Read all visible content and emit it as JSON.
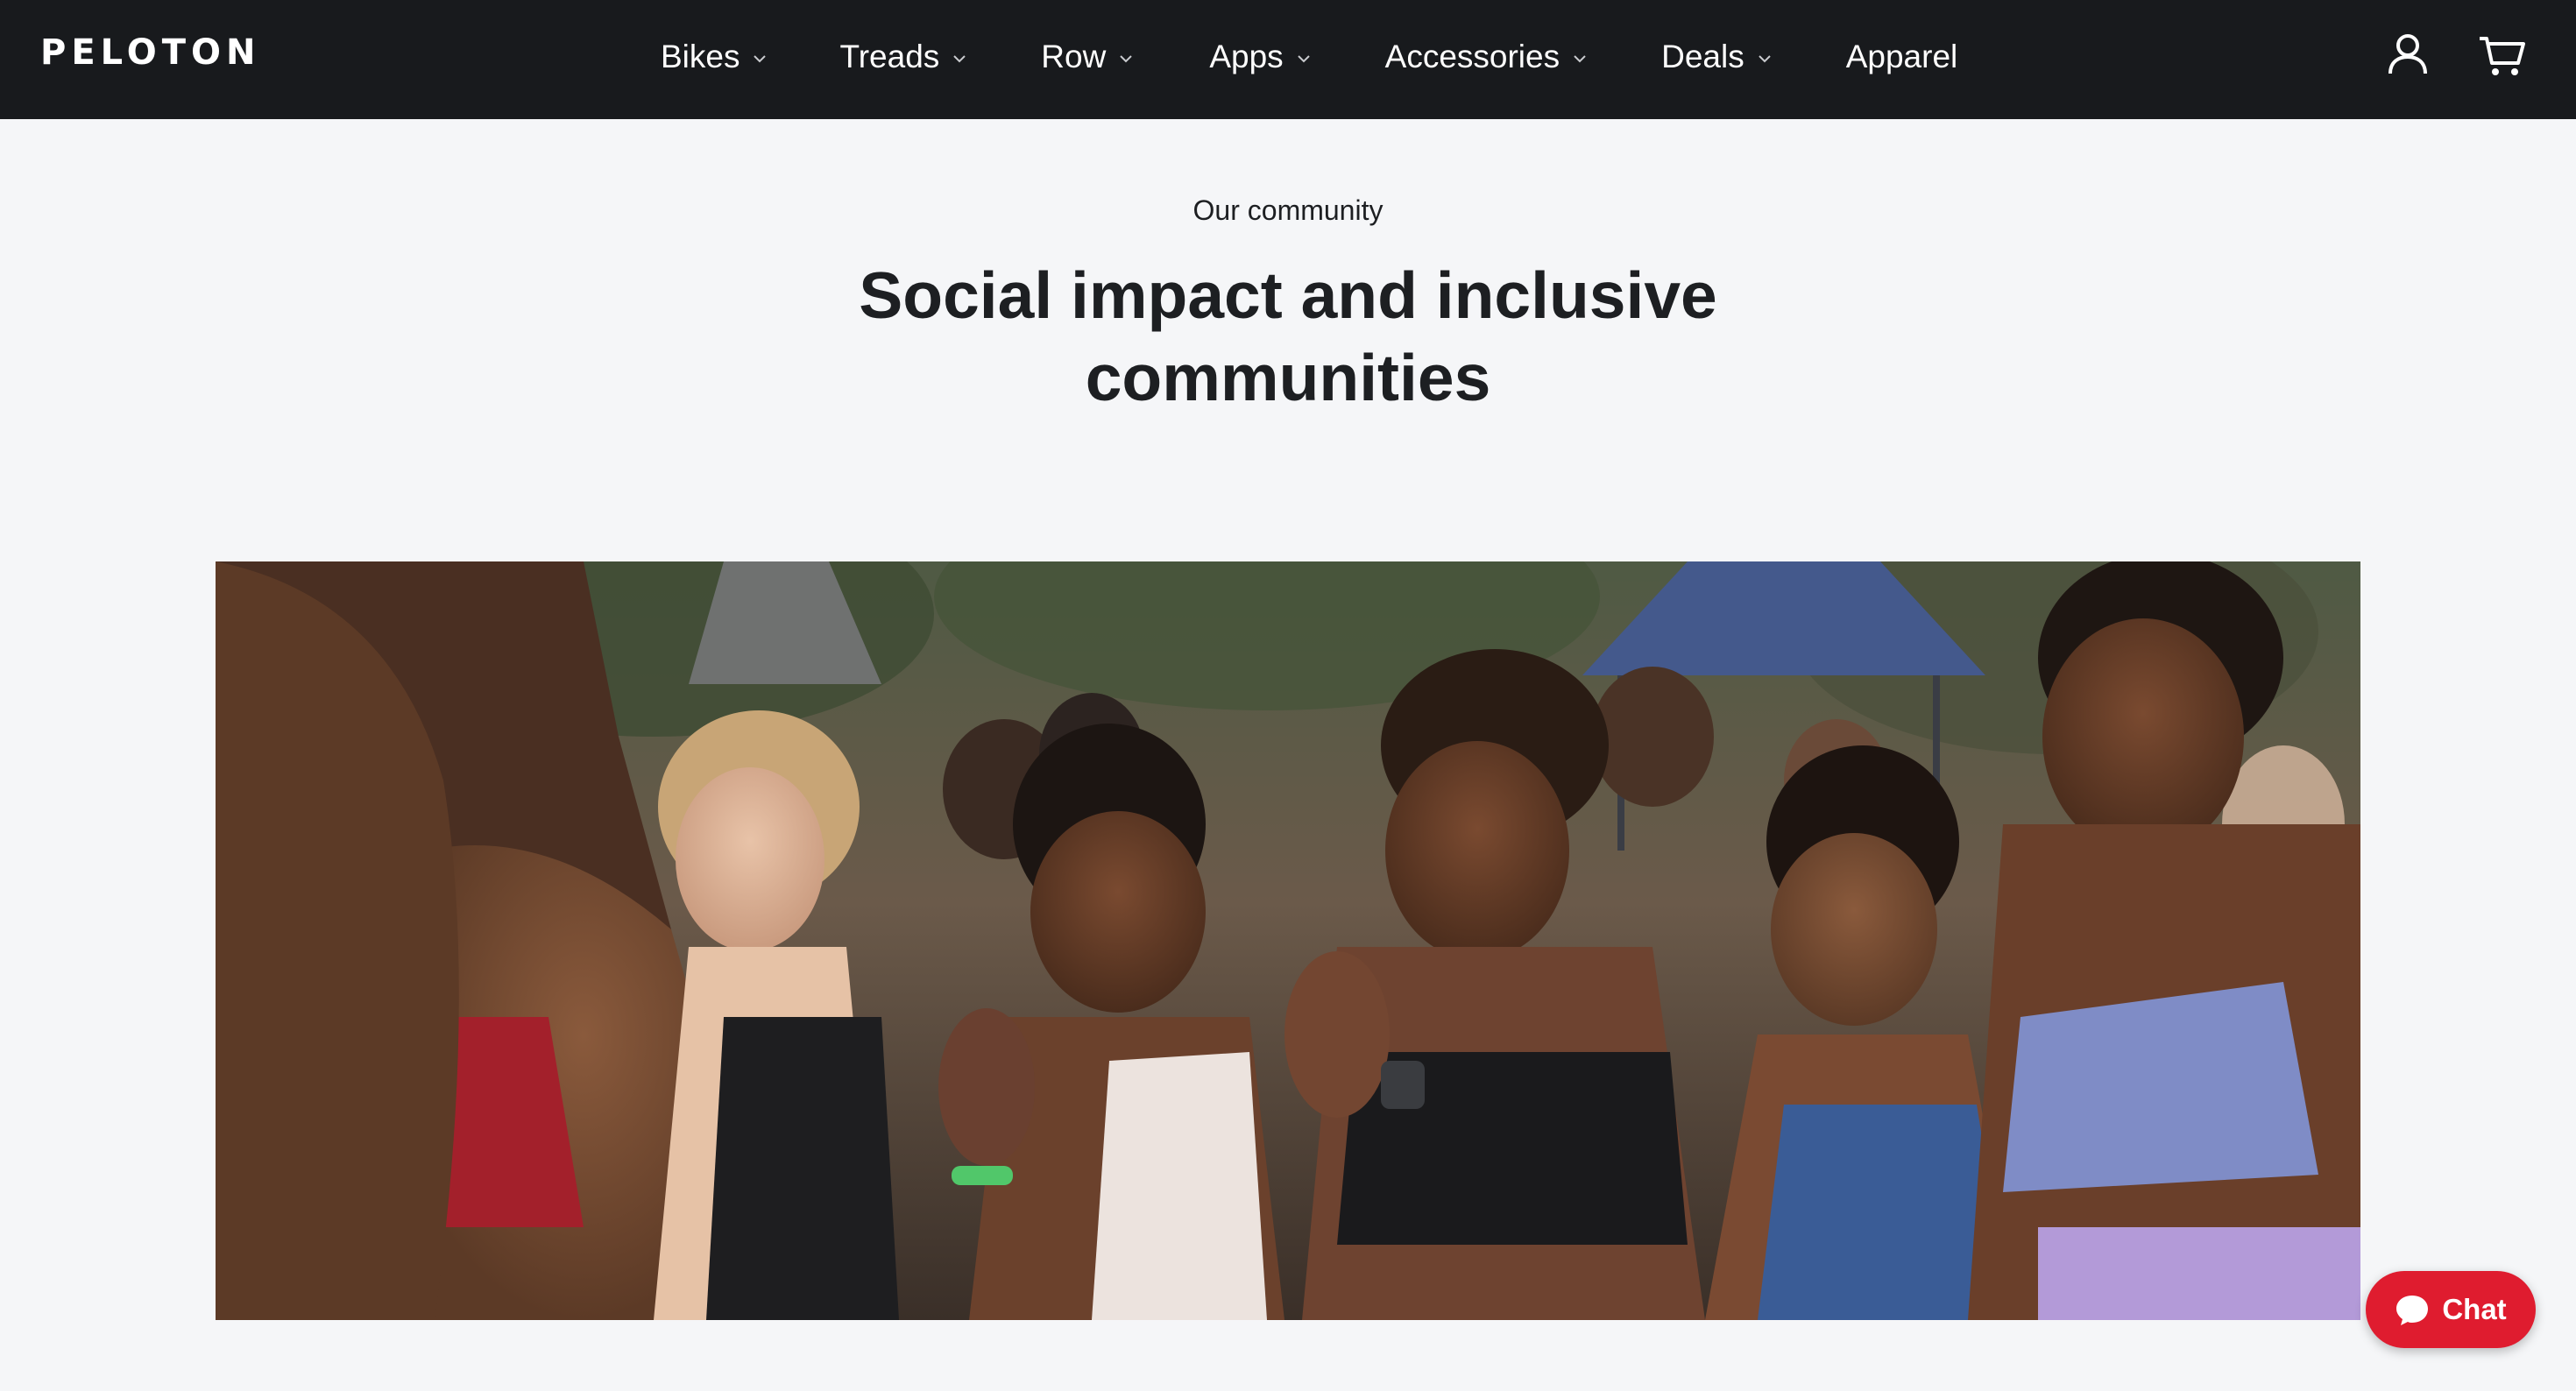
{
  "brand": {
    "logo_text": "PELOTON"
  },
  "nav": {
    "items": [
      {
        "label": "Bikes",
        "has_dropdown": true
      },
      {
        "label": "Treads",
        "has_dropdown": true
      },
      {
        "label": "Row",
        "has_dropdown": true
      },
      {
        "label": "Apps",
        "has_dropdown": true
      },
      {
        "label": "Accessories",
        "has_dropdown": true
      },
      {
        "label": "Deals",
        "has_dropdown": true
      },
      {
        "label": "Apparel",
        "has_dropdown": false
      }
    ],
    "icons": {
      "account": "user-icon",
      "cart": "cart-icon",
      "dropdown": "chevron-down-icon"
    }
  },
  "hero": {
    "eyebrow": "Our community",
    "headline_line1": "Social impact and inclusive",
    "headline_line2": "communities"
  },
  "photo": {
    "subject": "community-event-photo"
  },
  "chat": {
    "label": "Chat",
    "icon": "chat-bubble-icon"
  },
  "colors": {
    "nav_background": "#181a1d",
    "page_background": "#f5f6f8",
    "text_dark": "#1d1f22",
    "chat_red": "#df1c2f"
  }
}
